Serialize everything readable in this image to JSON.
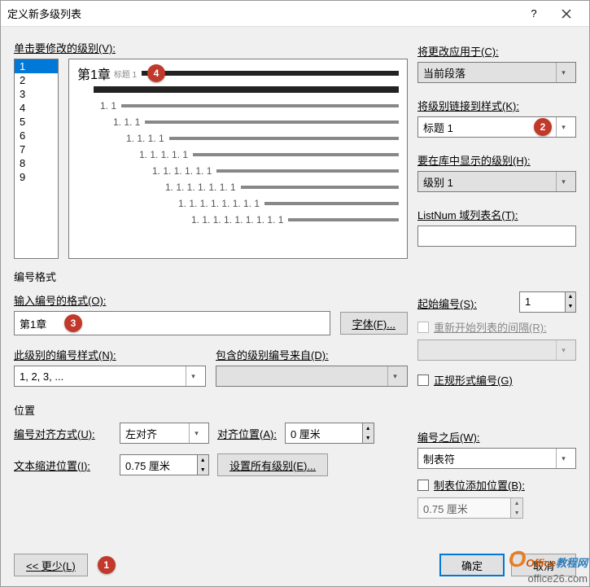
{
  "title": "定义新多级列表",
  "level_list_label": "单击要修改的级别(V):",
  "levels": [
    "1",
    "2",
    "3",
    "4",
    "5",
    "6",
    "7",
    "8",
    "9"
  ],
  "selected_level": "1",
  "preview": {
    "heading": "第1章",
    "heading_tag": "标题 1",
    "lines": [
      "1. 1",
      "1. 1. 1",
      "1. 1. 1. 1",
      "1. 1. 1. 1. 1",
      "1. 1. 1. 1. 1. 1",
      "1. 1. 1. 1. 1. 1. 1",
      "1. 1. 1. 1. 1. 1. 1. 1",
      "1. 1. 1. 1. 1. 1. 1. 1. 1"
    ]
  },
  "right": {
    "apply_to_label": "将更改应用于(C):",
    "apply_to_value": "当前段落",
    "link_style_label": "将级别链接到样式(K):",
    "link_style_value": "标题 1",
    "gallery_label": "要在库中显示的级别(H):",
    "gallery_value": "级别 1",
    "listnum_label": "ListNum 域列表名(T):",
    "listnum_value": ""
  },
  "format": {
    "section": "编号格式",
    "enter_format_label": "输入编号的格式(O):",
    "enter_format_value": "第1章",
    "font_btn": "字体(F)...",
    "style_label": "此级别的编号样式(N):",
    "style_value": "1, 2, 3, ...",
    "include_label": "包含的级别编号来自(D):",
    "include_value": "",
    "start_label": "起始编号(S):",
    "start_value": "1",
    "restart_label": "重新开始列表的间隔(R):",
    "restart_value": "",
    "legal_label": "正规形式编号(G)"
  },
  "pos": {
    "section": "位置",
    "align_label": "编号对齐方式(U):",
    "align_value": "左对齐",
    "align_at_label": "对齐位置(A):",
    "align_at_value": "0 厘米",
    "indent_label": "文本缩进位置(I):",
    "indent_value": "0.75 厘米",
    "set_all_btn": "设置所有级别(E)...",
    "follow_label": "编号之后(W):",
    "follow_value": "制表符",
    "tab_add_label": "制表位添加位置(B):",
    "tab_add_value": "0.75 厘米"
  },
  "buttons": {
    "less": "<< 更少(L)",
    "ok": "确定",
    "cancel": "取消"
  },
  "badges": {
    "b1": "1",
    "b2": "2",
    "b3": "3",
    "b4": "4"
  },
  "watermark": {
    "brand": "Office",
    "suffix": "教程网",
    "sub": "office26.com"
  }
}
